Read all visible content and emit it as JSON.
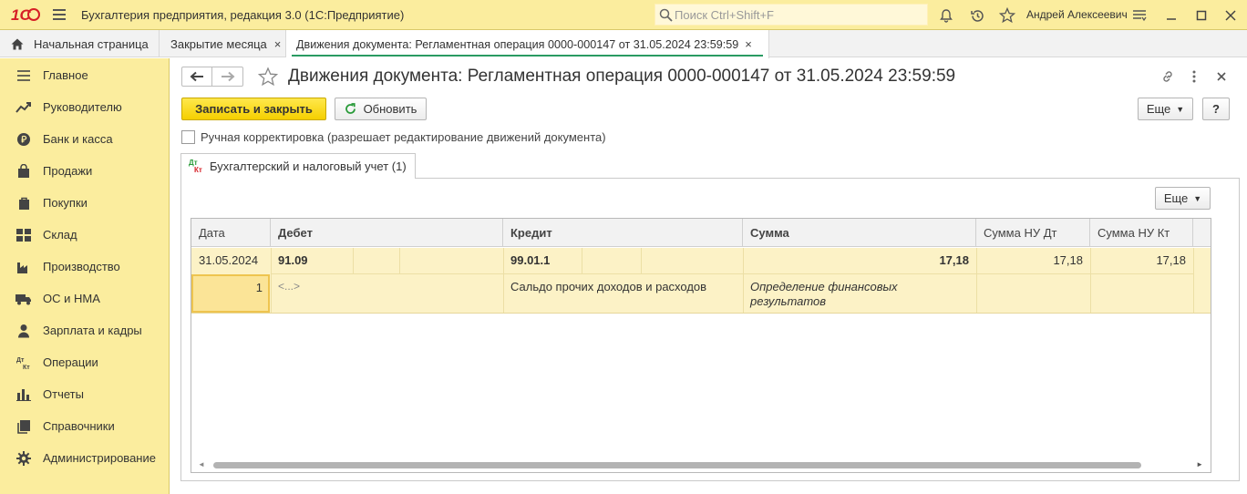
{
  "app": {
    "title": "Бухгалтерия предприятия, редакция 3.0  (1С:Предприятие)",
    "logo": "1С",
    "search_placeholder": "Поиск Ctrl+Shift+F",
    "user": "Андрей Алексеевич",
    "accent_color": "#fbed9e",
    "icons": [
      "hamburger-icon",
      "search-icon",
      "bell-icon",
      "history-icon",
      "star-icon",
      "settings-icon",
      "minimize-icon",
      "maximize-icon",
      "close-icon"
    ]
  },
  "tabs": [
    {
      "label": "Начальная страница",
      "icon": "home-icon"
    },
    {
      "label": "Закрытие месяца",
      "close": "×"
    },
    {
      "label": "Движения документа: Регламентная операция 0000-000147 от 31.05.2024 23:59:59",
      "close": "×",
      "active": true
    }
  ],
  "sidebar": {
    "items": [
      {
        "label": "Главное",
        "icon": "menu-lines-icon"
      },
      {
        "label": "Руководителю",
        "icon": "trend-icon"
      },
      {
        "label": "Банк и касса",
        "icon": "ruble-coin-icon"
      },
      {
        "label": "Продажи",
        "icon": "shopping-bag-icon"
      },
      {
        "label": "Покупки",
        "icon": "cart-icon"
      },
      {
        "label": "Склад",
        "icon": "warehouse-grid-icon"
      },
      {
        "label": "Производство",
        "icon": "factory-icon"
      },
      {
        "label": "ОС и НМА",
        "icon": "truck-icon"
      },
      {
        "label": "Зарплата и кадры",
        "icon": "person-icon"
      },
      {
        "label": "Операции",
        "icon": "dt-kt-icon"
      },
      {
        "label": "Отчеты",
        "icon": "bar-chart-icon"
      },
      {
        "label": "Справочники",
        "icon": "books-icon"
      },
      {
        "label": "Администрирование",
        "icon": "gear-icon"
      }
    ]
  },
  "document": {
    "title": "Движения документа: Регламентная операция 0000-000147 от 31.05.2024 23:59:59",
    "save_close": "Записать и закрыть",
    "refresh": "Обновить",
    "more": "Еще",
    "help": "?",
    "manual_edit_label": "Ручная корректировка (разрешает редактирование движений документа)",
    "manual_edit_checked": false,
    "register_tab": "Бухгалтерский и налоговый учет (1)",
    "register_icon_top": "Дт",
    "register_icon_bottom": "Кт",
    "table_more": "Еще"
  },
  "table": {
    "columns": [
      "Дата",
      "Дебет",
      "Кредит",
      "Сумма",
      "Сумма НУ Дт",
      "Сумма НУ Кт"
    ],
    "rows": [
      {
        "date": "31.05.2024",
        "number": "1",
        "debit_account": "91.09",
        "debit_subconto": "<...>",
        "credit_account": "99.01.1",
        "credit_subconto": "Сальдо прочих доходов и расходов",
        "amount": "17,18",
        "amount_content": "Определение финансовых результатов",
        "nu_dt": "17,18",
        "nu_kt": "17,18"
      }
    ]
  }
}
